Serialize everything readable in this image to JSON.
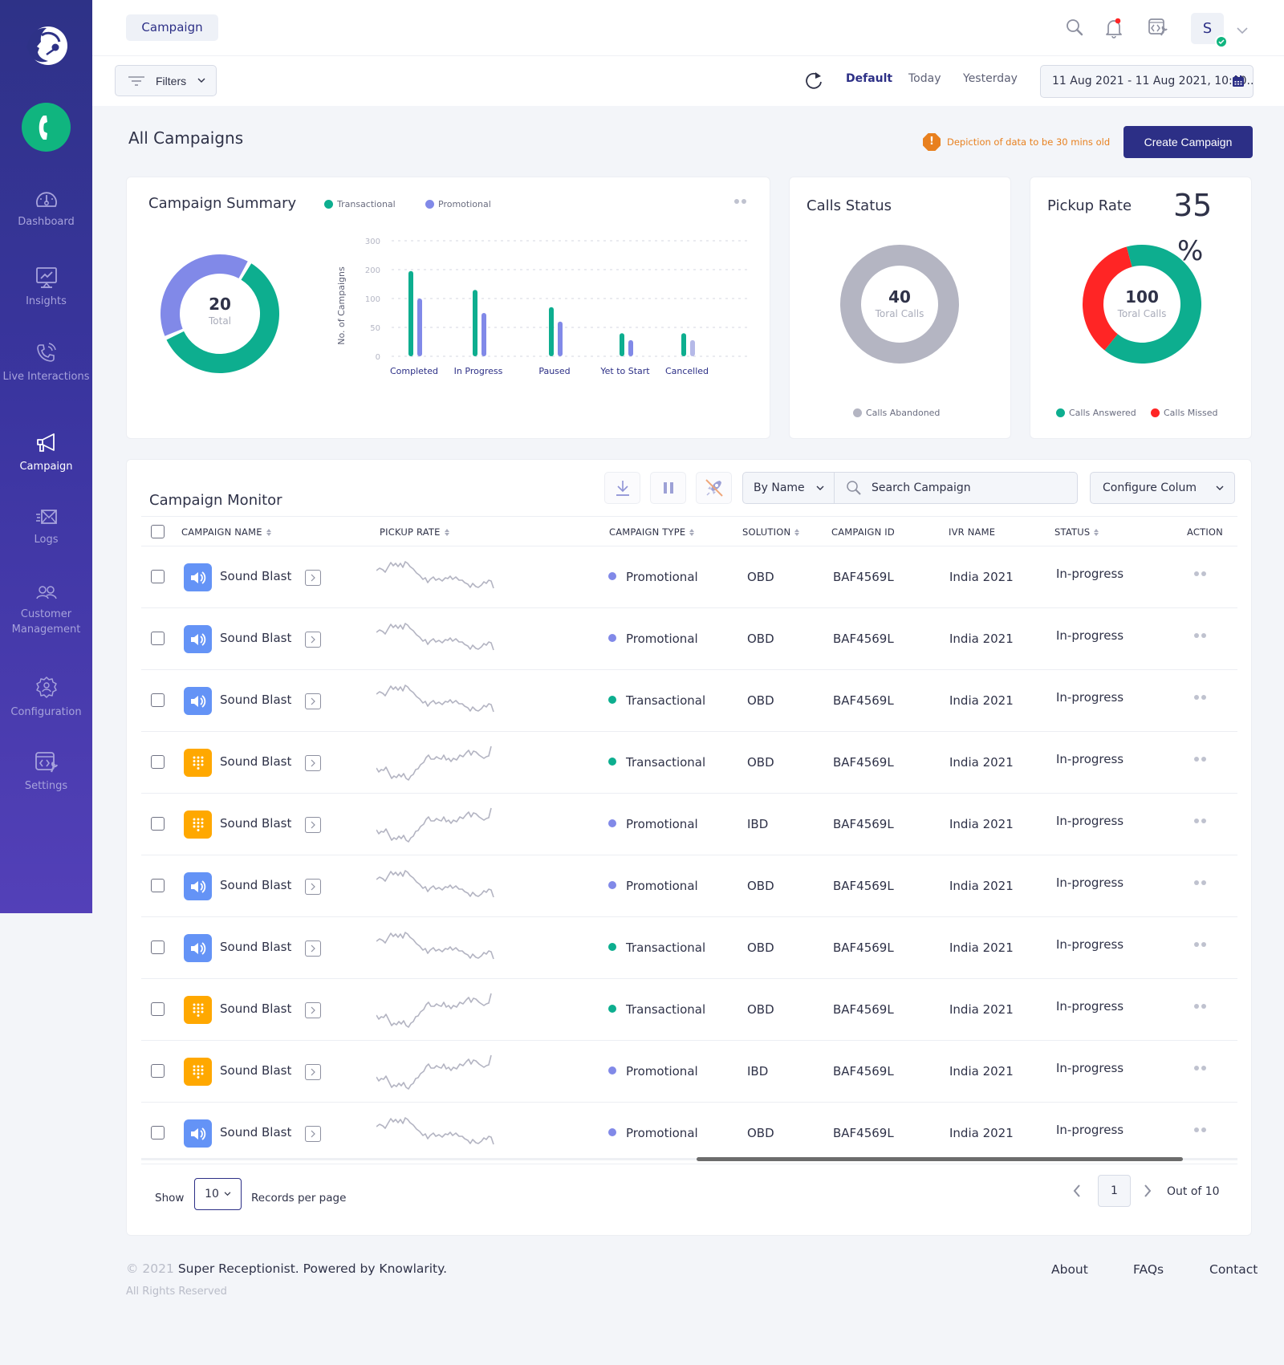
{
  "sidebar": {
    "items": [
      {
        "label": "Dashboard",
        "icon": "dashboard-gauge-icon",
        "active": false
      },
      {
        "label": "Insights",
        "icon": "insights-monitor-chart-icon",
        "active": false
      },
      {
        "label": "Live Interactions",
        "icon": "live-call-icon",
        "active": false
      },
      {
        "label": "Campaign",
        "icon": "megaphone-icon",
        "active": true
      },
      {
        "label": "Logs",
        "icon": "mail-logs-icon",
        "active": false
      },
      {
        "label": "Customer Management",
        "icon": "users-icon",
        "active": false
      },
      {
        "label": "Configuration",
        "icon": "gear-user-icon",
        "active": false
      },
      {
        "label": "Settings",
        "icon": "code-wrench-icon",
        "active": false
      }
    ]
  },
  "header": {
    "breadcrumb": "Campaign",
    "avatar_initial": "S",
    "avatar_status": "online"
  },
  "filterbar": {
    "filters_label": "Filters",
    "ranges": [
      "Default",
      "Today",
      "Yesterday"
    ],
    "active_range": "Default",
    "date_range": "11 Aug 2021 - 11 Aug 2021, 10:00..."
  },
  "page": {
    "title": "All Campaigns",
    "stale_note": "Depiction of data to be 30 mins old",
    "create_button": "Create Campaign"
  },
  "colors": {
    "brand": "#2c2f86",
    "transactional": "#0dae8f",
    "promotional": "#8189e8",
    "abandoned": "#b4b5c2",
    "missed": "#ff2525",
    "warning": "#e8801f",
    "speaker_icon_bg": "#6493f6",
    "keypad_icon_bg": "#ffa800"
  },
  "summary": {
    "title": "Campaign Summary",
    "legend": [
      "Transactional",
      "Promotional"
    ],
    "donut_total": "20",
    "donut_total_label": "Total"
  },
  "calls_status": {
    "title": "Calls Status",
    "total": "40",
    "total_label": "Toral Calls",
    "legend": [
      "Calls Abandoned"
    ]
  },
  "pickup_rate": {
    "title": "Pickup Rate",
    "value": "35",
    "unit": "%",
    "total": "100",
    "total_label": "Toral Calls",
    "legend": [
      "Calls Answered",
      "Calls Missed"
    ]
  },
  "chart_data": [
    {
      "type": "pie",
      "title": "Campaign Summary",
      "labels": [
        "Transactional",
        "Promotional"
      ],
      "values": [
        60,
        40
      ],
      "center_text": "20 Total"
    },
    {
      "type": "bar",
      "title": "Campaign Summary",
      "categories": [
        "Completed",
        "In Progress",
        "Paused",
        "Yet to Start",
        "Cancelled"
      ],
      "series": [
        {
          "name": "Transactional",
          "values": [
            195,
            130,
            85,
            40,
            40
          ]
        },
        {
          "name": "Promotional",
          "values": [
            100,
            75,
            60,
            28,
            28
          ]
        }
      ],
      "xlabel": "",
      "ylabel": "No. of Campaigns",
      "yticks": [
        0,
        50,
        100,
        200,
        300
      ],
      "ylim": [
        0,
        300
      ],
      "grid": true
    },
    {
      "type": "pie",
      "title": "Calls Status",
      "labels": [
        "Calls Abandoned"
      ],
      "values": [
        40
      ],
      "center_text": "40 Toral Calls"
    },
    {
      "type": "pie",
      "title": "Pickup Rate",
      "labels": [
        "Calls Answered",
        "Calls Missed"
      ],
      "values": [
        65,
        35
      ],
      "center_text": "100 Toral Calls"
    }
  ],
  "monitor": {
    "title": "Campaign Monitor",
    "by_name": "By Name",
    "search_placeholder": "Search Campaign",
    "configure_columns": "Configure Colum",
    "columns": [
      "CAMPAIGN NAME",
      "PICKUP RATE",
      "CAMPAIGN TYPE",
      "SOLUTION",
      "CAMPAIGN ID",
      "IVR NAME",
      "STATUS",
      "ACTION"
    ],
    "rows": [
      {
        "name": "Sound Blast",
        "icon": "speaker",
        "trend": "down",
        "type": "Promotional",
        "solution": "OBD",
        "id": "BAF4569L",
        "ivr": "India 2021",
        "status": "In-progress"
      },
      {
        "name": "Sound Blast",
        "icon": "speaker",
        "trend": "down",
        "type": "Promotional",
        "solution": "OBD",
        "id": "BAF4569L",
        "ivr": "India 2021",
        "status": "In-progress"
      },
      {
        "name": "Sound Blast",
        "icon": "speaker",
        "trend": "down",
        "type": "Transactional",
        "solution": "OBD",
        "id": "BAF4569L",
        "ivr": "India 2021",
        "status": "In-progress"
      },
      {
        "name": "Sound Blast",
        "icon": "keypad",
        "trend": "up",
        "type": "Transactional",
        "solution": "OBD",
        "id": "BAF4569L",
        "ivr": "India 2021",
        "status": "In-progress"
      },
      {
        "name": "Sound Blast",
        "icon": "keypad",
        "trend": "up",
        "type": "Promotional",
        "solution": "IBD",
        "id": "BAF4569L",
        "ivr": "India 2021",
        "status": "In-progress"
      },
      {
        "name": "Sound Blast",
        "icon": "speaker",
        "trend": "down",
        "type": "Promotional",
        "solution": "OBD",
        "id": "BAF4569L",
        "ivr": "India 2021",
        "status": "In-progress"
      },
      {
        "name": "Sound Blast",
        "icon": "speaker",
        "trend": "down",
        "type": "Transactional",
        "solution": "OBD",
        "id": "BAF4569L",
        "ivr": "India 2021",
        "status": "In-progress"
      },
      {
        "name": "Sound Blast",
        "icon": "keypad",
        "trend": "up",
        "type": "Transactional",
        "solution": "OBD",
        "id": "BAF4569L",
        "ivr": "India 2021",
        "status": "In-progress"
      },
      {
        "name": "Sound Blast",
        "icon": "keypad",
        "trend": "up",
        "type": "Promotional",
        "solution": "IBD",
        "id": "BAF4569L",
        "ivr": "India 2021",
        "status": "In-progress"
      },
      {
        "name": "Sound Blast",
        "icon": "speaker",
        "trend": "down",
        "type": "Promotional",
        "solution": "OBD",
        "id": "BAF4569L",
        "ivr": "India 2021",
        "status": "In-progress"
      }
    ],
    "pagination": {
      "show_label": "Show",
      "page_size": "10",
      "per_page_label": "Records per page",
      "current_page": "1",
      "out_of": "Out of 10"
    }
  },
  "footer": {
    "copyright_year": "© 2021",
    "brand_line": "Super Receptionist. Powered by Knowlarity.",
    "rights": "All Rights Reserved",
    "links": [
      "About",
      "FAQs",
      "Contact"
    ]
  }
}
